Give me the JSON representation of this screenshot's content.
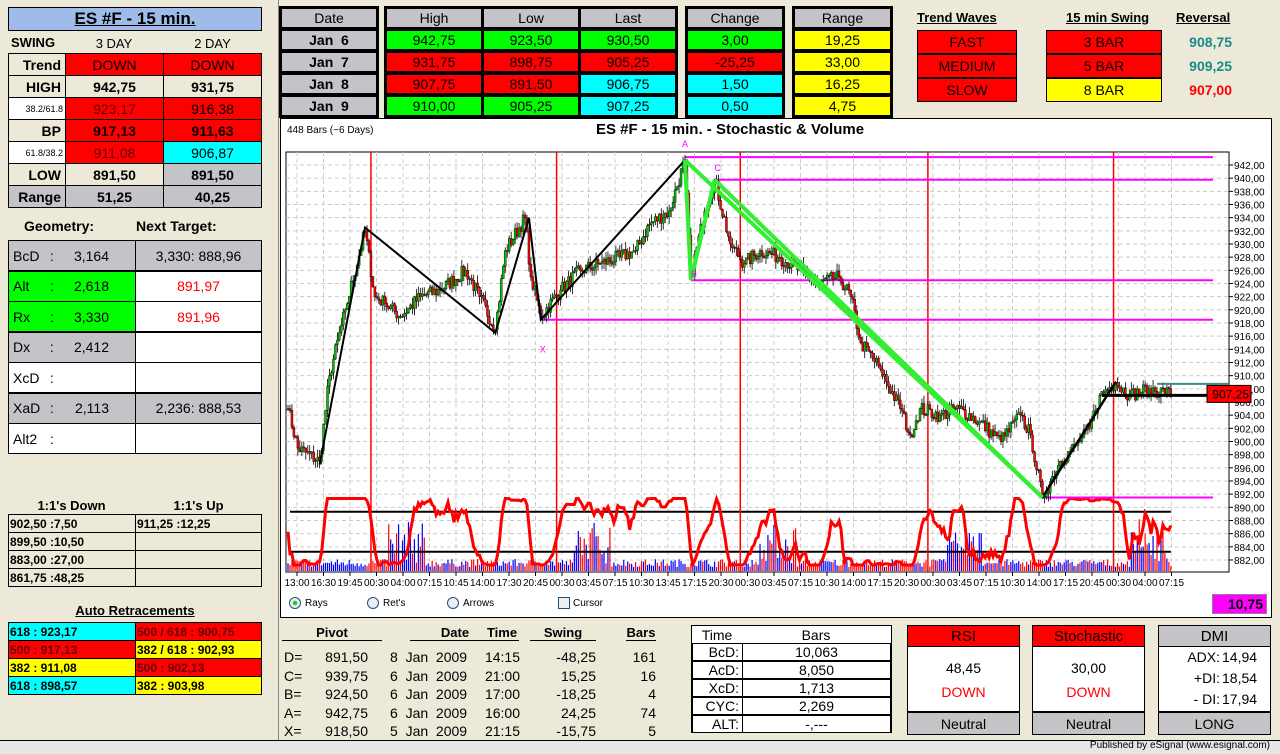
{
  "left": {
    "title": "ES #F - 15 min.",
    "swing_header": [
      "SWING",
      "3 DAY",
      "2 DAY"
    ],
    "rows": [
      {
        "label": "Trend",
        "a": "DOWN",
        "b": "DOWN"
      },
      {
        "label": "HIGH",
        "a": "942,75",
        "b": "931,75"
      },
      {
        "label": "38.2/61.8",
        "a": "923,17",
        "b": "916,38"
      },
      {
        "label": "BP",
        "a": "917,13",
        "b": "911,63"
      },
      {
        "label": "61.8/38.2",
        "a": "911,08",
        "b": "906,87"
      },
      {
        "label": "LOW",
        "a": "891,50",
        "b": "891,50"
      },
      {
        "label": "Range",
        "a": "51,25",
        "b": "40,25"
      }
    ],
    "geometry_label": "Geometry:",
    "next_target_label": "Next Target:",
    "geometry": [
      {
        "label": "BcD",
        "value": "3,164",
        "target": "3,330: 888,96"
      },
      {
        "label": "Alt",
        "value": "2,618",
        "target": "891,97"
      },
      {
        "label": "Rx",
        "value": "3,330",
        "target": "891,96"
      },
      {
        "label": "Dx",
        "value": "2,412",
        "target": ""
      },
      {
        "label": "XcD",
        "value": "",
        "target": ""
      },
      {
        "label": "XaD",
        "value": "2,113",
        "target": "2,236: 888,53"
      },
      {
        "label": "Alt2",
        "value": "",
        "target": ""
      }
    ],
    "ones_down_label": "1:1's Down",
    "ones_up_label": "1:1's Up",
    "ones": [
      {
        "down": "902,50 :7,50",
        "up": "911,25 :12,25"
      },
      {
        "down": "899,50 :10,50",
        "up": ""
      },
      {
        "down": "883,00 :27,00",
        "up": ""
      },
      {
        "down": "861,75 :48,25",
        "up": ""
      }
    ],
    "auto_ret_label": "Auto Retracements",
    "auto_ret": [
      {
        "a": "618 : 923,17",
        "b": "500 / 618 : 900,75"
      },
      {
        "a": "500 : 917,13",
        "b": "382 / 618 : 902,93"
      },
      {
        "a": "382 : 911,08",
        "b": "500 : 902,13"
      },
      {
        "a": "618 : 898,57",
        "b": "382 : 903,98"
      }
    ]
  },
  "daily": {
    "headers": [
      "Date",
      "High",
      "Low",
      "Last",
      "Change",
      "Range"
    ],
    "rows": [
      {
        "date": "Jan  6",
        "high": "942,75",
        "low": "923,50",
        "last": "930,50",
        "change": "3,00",
        "range": "19,25"
      },
      {
        "date": "Jan  7",
        "high": "931,75",
        "low": "898,75",
        "last": "905,25",
        "change": "-25,25",
        "range": "33,00"
      },
      {
        "date": "Jan  8",
        "high": "907,75",
        "low": "891,50",
        "last": "906,75",
        "change": "1,50",
        "range": "16,25"
      },
      {
        "date": "Jan  9",
        "high": "910,00",
        "low": "905,25",
        "last": "907,25",
        "change": "0,50",
        "range": "4,75"
      }
    ]
  },
  "trend": {
    "waves_label": "Trend Waves",
    "swing_label": "15 min Swing",
    "reversal_label": "Reversal",
    "rows": [
      {
        "wave": "FAST",
        "swing": "3 BAR",
        "reversal": "908,75"
      },
      {
        "wave": "MEDIUM",
        "swing": "5 BAR",
        "reversal": "909,25"
      },
      {
        "wave": "SLOW",
        "swing": "8 BAR",
        "reversal": "907,00"
      }
    ]
  },
  "chart_data": {
    "type": "candlestick",
    "title": "ES #F - 15 min. - Stochastic & Volume",
    "bars_info": "448 Bars (~6 Days)",
    "ylim": [
      881,
      943
    ],
    "y_ticks": [
      "942,00",
      "940,00",
      "938,00",
      "936,00",
      "934,00",
      "932,00",
      "930,00",
      "928,00",
      "926,00",
      "924,00",
      "922,00",
      "920,00",
      "918,00",
      "916,00",
      "914,00",
      "912,00",
      "910,00",
      "908,00",
      "906,00",
      "904,00",
      "902,00",
      "900,00",
      "898,00",
      "896,00",
      "894,00",
      "892,00",
      "890,00",
      "888,00",
      "886,00",
      "884,00",
      "882,00"
    ],
    "x_ticks": [
      "13:00",
      "16:30",
      "19:45",
      "00:30",
      "04:00",
      "07:15",
      "10:45",
      "14:00",
      "17:30",
      "20:45",
      "00:30",
      "03:45",
      "07:15",
      "10:30",
      "13:45",
      "17:15",
      "20:30",
      "00:30",
      "03:45",
      "07:15",
      "10:30",
      "14:00",
      "17:15",
      "20:30",
      "00:30",
      "03:45",
      "07:15",
      "10:30",
      "14:00",
      "17:15",
      "20:45",
      "00:30",
      "04:00",
      "07:15"
    ],
    "price_path": [
      [
        0,
        905
      ],
      [
        5,
        899
      ],
      [
        16,
        897
      ],
      [
        21,
        910
      ],
      [
        29,
        920
      ],
      [
        39,
        932
      ],
      [
        44,
        922
      ],
      [
        49,
        921
      ],
      [
        57,
        919
      ],
      [
        67,
        922
      ],
      [
        77,
        923
      ],
      [
        90,
        926
      ],
      [
        97,
        922
      ],
      [
        105,
        917
      ],
      [
        110,
        929
      ],
      [
        120,
        934
      ],
      [
        123,
        925
      ],
      [
        128,
        919
      ],
      [
        138,
        923
      ],
      [
        148,
        926
      ],
      [
        158,
        927
      ],
      [
        168,
        928
      ],
      [
        176,
        929
      ],
      [
        183,
        933
      ],
      [
        193,
        935
      ],
      [
        201,
        942.75
      ],
      [
        204,
        925
      ],
      [
        211,
        935
      ],
      [
        216,
        939.75
      ],
      [
        224,
        930
      ],
      [
        231,
        927
      ],
      [
        239,
        929
      ],
      [
        249,
        928
      ],
      [
        259,
        926
      ],
      [
        269,
        924
      ],
      [
        279,
        925
      ],
      [
        285,
        922
      ],
      [
        290,
        915
      ],
      [
        300,
        911
      ],
      [
        310,
        905
      ],
      [
        315,
        901
      ],
      [
        320,
        905
      ],
      [
        330,
        904
      ],
      [
        340,
        905
      ],
      [
        350,
        903
      ],
      [
        361,
        900
      ],
      [
        371,
        904
      ],
      [
        376,
        901
      ],
      [
        382,
        891.5
      ],
      [
        391,
        897
      ],
      [
        401,
        900
      ],
      [
        406,
        902
      ],
      [
        411,
        907
      ],
      [
        419,
        909
      ],
      [
        426,
        907
      ],
      [
        436,
        908
      ],
      [
        447,
        907.25
      ]
    ],
    "day_separators": [
      42,
      136,
      229,
      324,
      418
    ],
    "pivots": [
      {
        "name": "X",
        "bar": 128,
        "price": 918.5
      },
      {
        "name": "A",
        "bar": 201,
        "price": 942.75
      },
      {
        "name": "B",
        "bar": 204,
        "price": 924.5
      },
      {
        "name": "C",
        "bar": 216,
        "price": 939.75
      },
      {
        "name": "D",
        "bar": 382,
        "price": 891.5
      }
    ],
    "zigzag": [
      [
        16,
        896.5
      ],
      [
        39,
        932.5
      ],
      [
        105,
        916.5
      ],
      [
        122,
        934
      ],
      [
        128,
        918.5
      ],
      [
        201,
        942.75
      ]
    ],
    "zigzag2": [
      [
        382,
        891.5
      ],
      [
        419,
        909
      ]
    ],
    "stoch_levels": [
      80,
      20
    ],
    "last_price_label": "907,25",
    "reversal_line": 908.75,
    "corner_value": "10,75"
  },
  "chart_options": {
    "rays": "Rays",
    "rets": "Ret's",
    "arrows": "Arrows",
    "cursor": "Cursor"
  },
  "pivots": {
    "headers": [
      "Pivot",
      "Date",
      "Time",
      "Swing",
      "Bars"
    ],
    "rows": [
      {
        "name": "D=",
        "price": "891,50",
        "date": "8  Jan  2009",
        "time": "14:15",
        "swing": "-48,25",
        "bars": "161"
      },
      {
        "name": "C=",
        "price": "939,75",
        "date": "6  Jan  2009",
        "time": "21:00",
        "swing": "15,25",
        "bars": "16"
      },
      {
        "name": "B=",
        "price": "924,50",
        "date": "6  Jan  2009",
        "time": "17:00",
        "swing": "-18,25",
        "bars": "4"
      },
      {
        "name": "A=",
        "price": "942,75",
        "date": "6  Jan  2009",
        "time": "16:00",
        "swing": "24,25",
        "bars": "74"
      },
      {
        "name": "X=",
        "price": "918,50",
        "date": "5  Jan  2009",
        "time": "21:15",
        "swing": "-15,75",
        "bars": "5"
      }
    ]
  },
  "timebars": {
    "headers": [
      "Time",
      "Bars"
    ],
    "rows": [
      {
        "k": "BcD:",
        "v": "10,063"
      },
      {
        "k": "AcD:",
        "v": "8,050"
      },
      {
        "k": "XcD:",
        "v": "1,713"
      },
      {
        "k": "CYC:",
        "v": "2,269"
      },
      {
        "k": "ALT:",
        "v": "-,---"
      }
    ]
  },
  "rsi": {
    "title": "RSI",
    "value": "48,45",
    "dir": "DOWN",
    "status": "Neutral"
  },
  "stoch": {
    "title": "Stochastic",
    "value": "30,00",
    "dir": "DOWN",
    "status": "Neutral"
  },
  "dmi": {
    "title": "DMI",
    "adx_label": "ADX:",
    "adx": "14,94",
    "pdi_label": "+DI:",
    "pdi": "18,54",
    "mdi_label": "- DI:",
    "mdi": "17,94",
    "status": "LONG"
  },
  "footer": "Published by eSignal (www.esignal.com)"
}
